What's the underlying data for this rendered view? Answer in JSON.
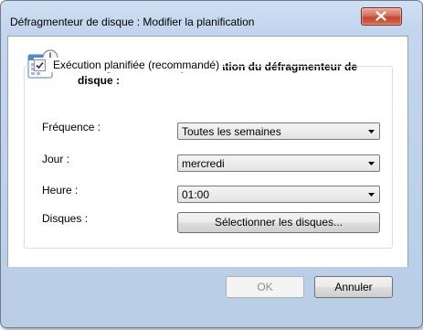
{
  "window": {
    "title": "Défragmenteur de disque : Modifier la planification"
  },
  "icons": {
    "calendar": "calendar-clock-icon",
    "close": "close-icon",
    "dropdown": "chevron-down-icon",
    "check": "check-icon"
  },
  "heading": "Configuration de la planification du défragmenteur de disque :",
  "schedule": {
    "checkbox_label": "Exécution planifiée (recommandé)",
    "checked": true,
    "frequency": {
      "label": "Fréquence :",
      "value": "Toutes les semaines"
    },
    "day": {
      "label": "Jour :",
      "value": "mercredi"
    },
    "time": {
      "label": "Heure :",
      "value": "01:00"
    },
    "disks": {
      "label": "Disques :",
      "button": "Sélectionner les disques..."
    }
  },
  "footer": {
    "ok": "OK",
    "ok_enabled": false,
    "cancel": "Annuler"
  },
  "colors": {
    "title_bar": "#c3d6ed",
    "close_button": "#c04a30",
    "client_bg": "#ffffff"
  }
}
